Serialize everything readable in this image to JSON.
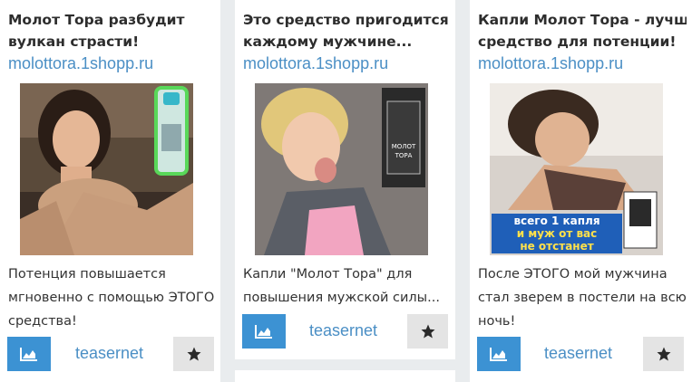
{
  "brand_color": "#4b8fc5",
  "button_color": "#3c92d3",
  "cards": [
    {
      "title_lines": [
        "Молот Тора разбудит",
        "вулкан страсти!"
      ],
      "domain": "molottora.1shopp.ru",
      "image_label": "",
      "desc_lines": [
        "Потенция повышается",
        "мгновенно с помощью ЭТОГО",
        "средства!"
      ],
      "brand": "teasernet",
      "chart_icon": "area-chart-icon",
      "star_icon": "star-icon"
    },
    {
      "title_lines": [
        "Это средство пригодится",
        "каждому мужчине..."
      ],
      "domain": "molottora.1shopp.ru",
      "image_label": "",
      "desc_lines": [
        "Капли \"Молот Тора\" для",
        "повышения мужской силы..."
      ],
      "brand": "teasernet",
      "chart_icon": "area-chart-icon",
      "star_icon": "star-icon"
    },
    {
      "title_lines": [
        "Капли Молот Тора - лучшее",
        "средство для потенции!"
      ],
      "domain": "molottora.1shopp.ru",
      "image_label": "",
      "banner_lines": [
        "всего 1 капля",
        "и муж от вас",
        "не отстанет"
      ],
      "desc_lines": [
        "После ЭТОГО мой мужчина",
        "стал зверем в постели на всю",
        "ночь!"
      ],
      "brand": "teasernet",
      "chart_icon": "area-chart-icon",
      "star_icon": "star-icon"
    }
  ],
  "product_box_text": [
    "МОЛОТ",
    "ТОРА"
  ]
}
